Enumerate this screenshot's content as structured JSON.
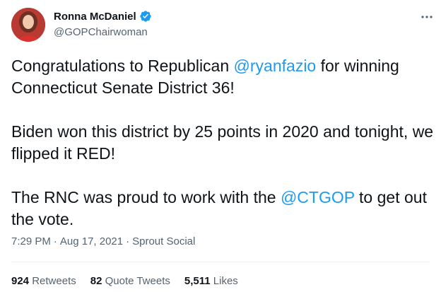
{
  "author": {
    "display_name": "Ronna McDaniel",
    "handle": "@GOPChairwoman",
    "verified": true,
    "avatar_icon": "profile-photo",
    "verified_icon": "verified-badge-icon",
    "verified_color": "#1d9bf0"
  },
  "tweet": {
    "paragraphs": [
      {
        "parts": [
          {
            "text": "Congratulations to Republican ",
            "mention": false
          },
          {
            "text": "@ryanfazio",
            "mention": true
          },
          {
            "text": " for winning Connecticut Senate District 36!",
            "mention": false
          }
        ]
      },
      {
        "parts": [
          {
            "text": "Biden won this district by 25 points in 2020 and tonight, we flipped it RED!",
            "mention": false
          }
        ]
      },
      {
        "parts": [
          {
            "text": "The RNC was proud to work with the ",
            "mention": false
          },
          {
            "text": "@CTGOP",
            "mention": true
          },
          {
            "text": " to get out the vote.",
            "mention": false
          }
        ]
      }
    ]
  },
  "meta": {
    "time": "7:29 PM",
    "separator": "·",
    "date": "Aug 17, 2021",
    "source": "Sprout Social"
  },
  "stats": {
    "retweets_count": "924",
    "retweets_label": "Retweets",
    "quotes_count": "82",
    "quotes_label": "Quote Tweets",
    "likes_count": "5,511",
    "likes_label": "Likes"
  },
  "colors": {
    "text": "#0f1419",
    "secondary": "#536471",
    "link": "#1d9bf0",
    "divider": "#eff3f4"
  }
}
